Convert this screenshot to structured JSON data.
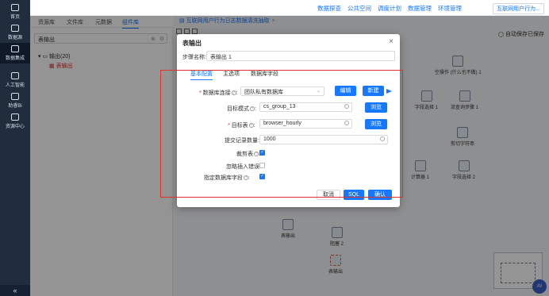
{
  "nav": {
    "items": [
      {
        "label": "首页",
        "icon": "home-icon"
      },
      {
        "label": "数据源",
        "icon": "datasource-icon"
      },
      {
        "label": "数据集成",
        "icon": "integration-icon"
      },
      {
        "label": "人工智能",
        "icon": "ai-icon"
      },
      {
        "label": "助睿Bi",
        "icon": "bi-icon"
      },
      {
        "label": "资源中心",
        "icon": "resource-icon"
      }
    ],
    "collapse": "«"
  },
  "topbar": {
    "menu": [
      "数据探查",
      "公共空间",
      "调度计划",
      "数据管理",
      "环境管理"
    ],
    "user": "互联网用户行为..."
  },
  "workspace_tabs": [
    "资源库",
    "文件库",
    "元数据",
    "组件库"
  ],
  "search": {
    "value": "表输出",
    "clear": "⊗"
  },
  "tree": {
    "folder": "输出(20)",
    "leaf": "表输出"
  },
  "doc_tab": {
    "label": "互联网用户行为日志数据清洗抽取"
  },
  "autosave": "自动保存已保存",
  "canvas_nodes": [
    "空操作 (什么也不做) 1",
    "字段选择 1",
    "流查询步骤 1",
    "剪切字符串",
    "计算器 1",
    "字段选择 2",
    "表输出",
    "阻塞 2",
    "表输出"
  ],
  "modal": {
    "title": "表输出",
    "close": "×",
    "step_label": "步骤名称:",
    "step_value": "表输出 1",
    "tabs": [
      "基本配置",
      "主选项",
      "数据库字段"
    ],
    "fields": {
      "db_label": "数据库连接",
      "db_value": "团队私有数据库",
      "edit_btn": "编辑",
      "new_btn": "新建",
      "schema_label": "目标模式",
      "schema_value": "cs_group_13",
      "browse1": "浏览",
      "table_label": "目标表",
      "table_value": "browser_hourly",
      "browse2": "浏览",
      "commit_label": "提交记录数量:",
      "commit_value": "1000",
      "truncate_label": "裁剪表",
      "ignore_label": "忽略插入错误",
      "specify_label": "指定数据库字段"
    },
    "footer": {
      "cancel": "取消",
      "sql": "SQL",
      "ok": "确认"
    }
  }
}
